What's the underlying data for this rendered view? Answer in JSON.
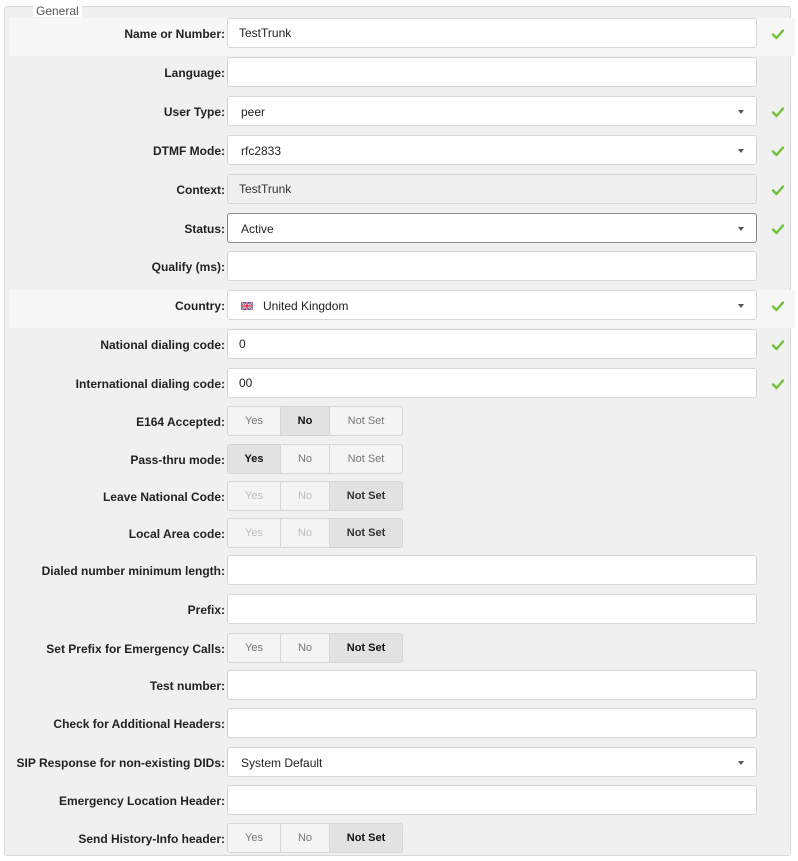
{
  "legend": "General",
  "colors": {
    "check": "#6fc23a",
    "border": "#d6d6d6",
    "panel": "#f0f0f0"
  },
  "fields": {
    "name_or_number": {
      "label": "Name or Number:",
      "value": "TestTrunk",
      "valid": true
    },
    "language": {
      "label": "Language:",
      "value": ""
    },
    "user_type": {
      "label": "User Type:",
      "value": "peer",
      "valid": true
    },
    "dtmf_mode": {
      "label": "DTMF Mode:",
      "value": "rfc2833",
      "valid": true
    },
    "context": {
      "label": "Context:",
      "value": "TestTrunk",
      "valid": true,
      "disabled": true
    },
    "status": {
      "label": "Status:",
      "value": "Active",
      "valid": true
    },
    "qualify": {
      "label": "Qualify (ms):",
      "value": ""
    },
    "country": {
      "label": "Country:",
      "value": "United Kingdom",
      "flag_icon": "uk-flag-icon",
      "valid": true
    },
    "national_dialing_code": {
      "label": "National dialing code:",
      "value": "0",
      "valid": true
    },
    "international_dialing_code": {
      "label": "International dialing code:",
      "value": "00",
      "valid": true
    },
    "e164_accepted": {
      "label": "E164 Accepted:",
      "options": [
        "Yes",
        "No",
        "Not Set"
      ],
      "selected": "No"
    },
    "pass_thru_mode": {
      "label": "Pass-thru mode:",
      "options": [
        "Yes",
        "No",
        "Not Set"
      ],
      "selected": "Yes"
    },
    "leave_national_code": {
      "label": "Leave National Code:",
      "options": [
        "Yes",
        "No",
        "Not Set"
      ],
      "selected": "Not Set",
      "disabled": true
    },
    "local_area_code": {
      "label": "Local Area code:",
      "options": [
        "Yes",
        "No",
        "Not Set"
      ],
      "selected": "Not Set",
      "disabled": true
    },
    "dialed_number_min_length": {
      "label": "Dialed number minimum length:",
      "value": ""
    },
    "prefix": {
      "label": "Prefix:",
      "value": ""
    },
    "set_prefix_emergency": {
      "label": "Set Prefix for Emergency Calls:",
      "options": [
        "Yes",
        "No",
        "Not Set"
      ],
      "selected": "Not Set"
    },
    "test_number": {
      "label": "Test number:",
      "value": ""
    },
    "check_additional_headers": {
      "label": "Check for Additional Headers:",
      "value": ""
    },
    "sip_response_nonexisting_dids": {
      "label": "SIP Response for non-existing DIDs:",
      "value": "System Default"
    },
    "emergency_location_header": {
      "label": "Emergency Location Header:",
      "value": ""
    },
    "send_history_info_header": {
      "label": "Send History-Info header:",
      "options": [
        "Yes",
        "No",
        "Not Set"
      ],
      "selected": "Not Set"
    }
  }
}
